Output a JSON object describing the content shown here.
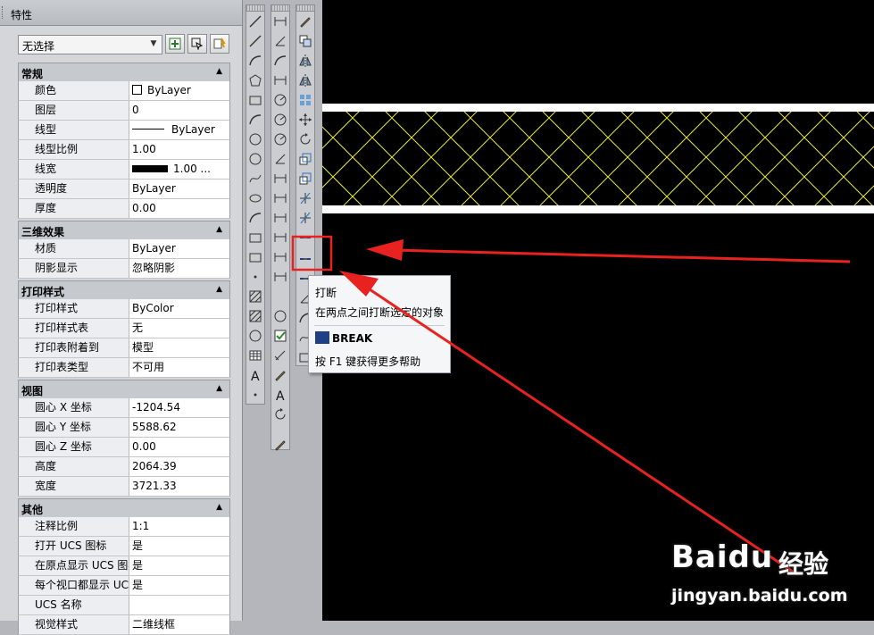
{
  "panel": {
    "title": "特性",
    "selection": "无选择"
  },
  "categories": [
    {
      "title": "常规",
      "rows": [
        {
          "label": "颜色",
          "value": "ByLayer",
          "swatch": true
        },
        {
          "label": "图层",
          "value": "0"
        },
        {
          "label": "线型",
          "value": "ByLayer",
          "linetype": true
        },
        {
          "label": "线型比例",
          "value": "1.00"
        },
        {
          "label": "线宽",
          "value": "1.00 ...",
          "lineweight": true
        },
        {
          "label": "透明度",
          "value": "ByLayer"
        },
        {
          "label": "厚度",
          "value": "0.00"
        }
      ]
    },
    {
      "title": "三维效果",
      "rows": [
        {
          "label": "材质",
          "value": "ByLayer"
        },
        {
          "label": "阴影显示",
          "value": "忽略阴影"
        }
      ]
    },
    {
      "title": "打印样式",
      "rows": [
        {
          "label": "打印样式",
          "value": "ByColor"
        },
        {
          "label": "打印样式表",
          "value": "无"
        },
        {
          "label": "打印表附着到",
          "value": "模型"
        },
        {
          "label": "打印表类型",
          "value": "不可用"
        }
      ]
    },
    {
      "title": "视图",
      "rows": [
        {
          "label": "圆心 X 坐标",
          "value": "-1204.54"
        },
        {
          "label": "圆心 Y 坐标",
          "value": "5588.62"
        },
        {
          "label": "圆心 Z 坐标",
          "value": "0.00"
        },
        {
          "label": "高度",
          "value": "2064.39"
        },
        {
          "label": "宽度",
          "value": "3721.33"
        }
      ]
    },
    {
      "title": "其他",
      "rows": [
        {
          "label": "注释比例",
          "value": "1:1"
        },
        {
          "label": "打开 UCS 图标",
          "value": "是"
        },
        {
          "label": "在原点显示 UCS 图标",
          "value": "是"
        },
        {
          "label": "每个视口都显示 UCS",
          "value": "是"
        },
        {
          "label": "UCS 名称",
          "value": ""
        },
        {
          "label": "视觉样式",
          "value": "二维线框"
        }
      ]
    }
  ],
  "tooltip": {
    "title": "打断",
    "description": "在两点之间打断选定的对象",
    "command": "BREAK",
    "help": "按 F1 键获得更多帮助"
  },
  "watermark": {
    "brand": "Baidu",
    "product": "经验",
    "url": "jingyan.baidu.com"
  },
  "colors": {
    "hatch": "#e6e64a",
    "arrow": "#e8231f",
    "highlight_box": "#e8231f",
    "canvas": "#000000"
  }
}
